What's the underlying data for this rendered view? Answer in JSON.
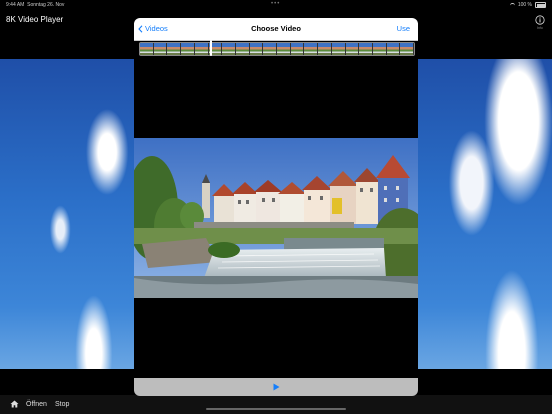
{
  "status_bar": {
    "time": "9:44 AM",
    "date": "Sonntag 26. Nov",
    "dots": "•••",
    "battery": "100 %"
  },
  "app": {
    "title": "8K Video Player",
    "info_hint": "i",
    "tiny_label": "Info"
  },
  "picker": {
    "back_label": "Videos",
    "title": "Choose Video",
    "use_label": "Use",
    "filmstrip_frames": 20,
    "playhead_position": 0.26
  },
  "toolbar": {
    "open_label": "Öffnen",
    "stop_label": "Stop"
  },
  "colors": {
    "accent": "#147efb",
    "controls_bg": "#bdbdbd",
    "toolbar_bg": "#111111"
  },
  "icons": {
    "back": "chevron-left-icon",
    "info": "info-circle-icon",
    "home": "house-icon",
    "play": "play-icon"
  }
}
